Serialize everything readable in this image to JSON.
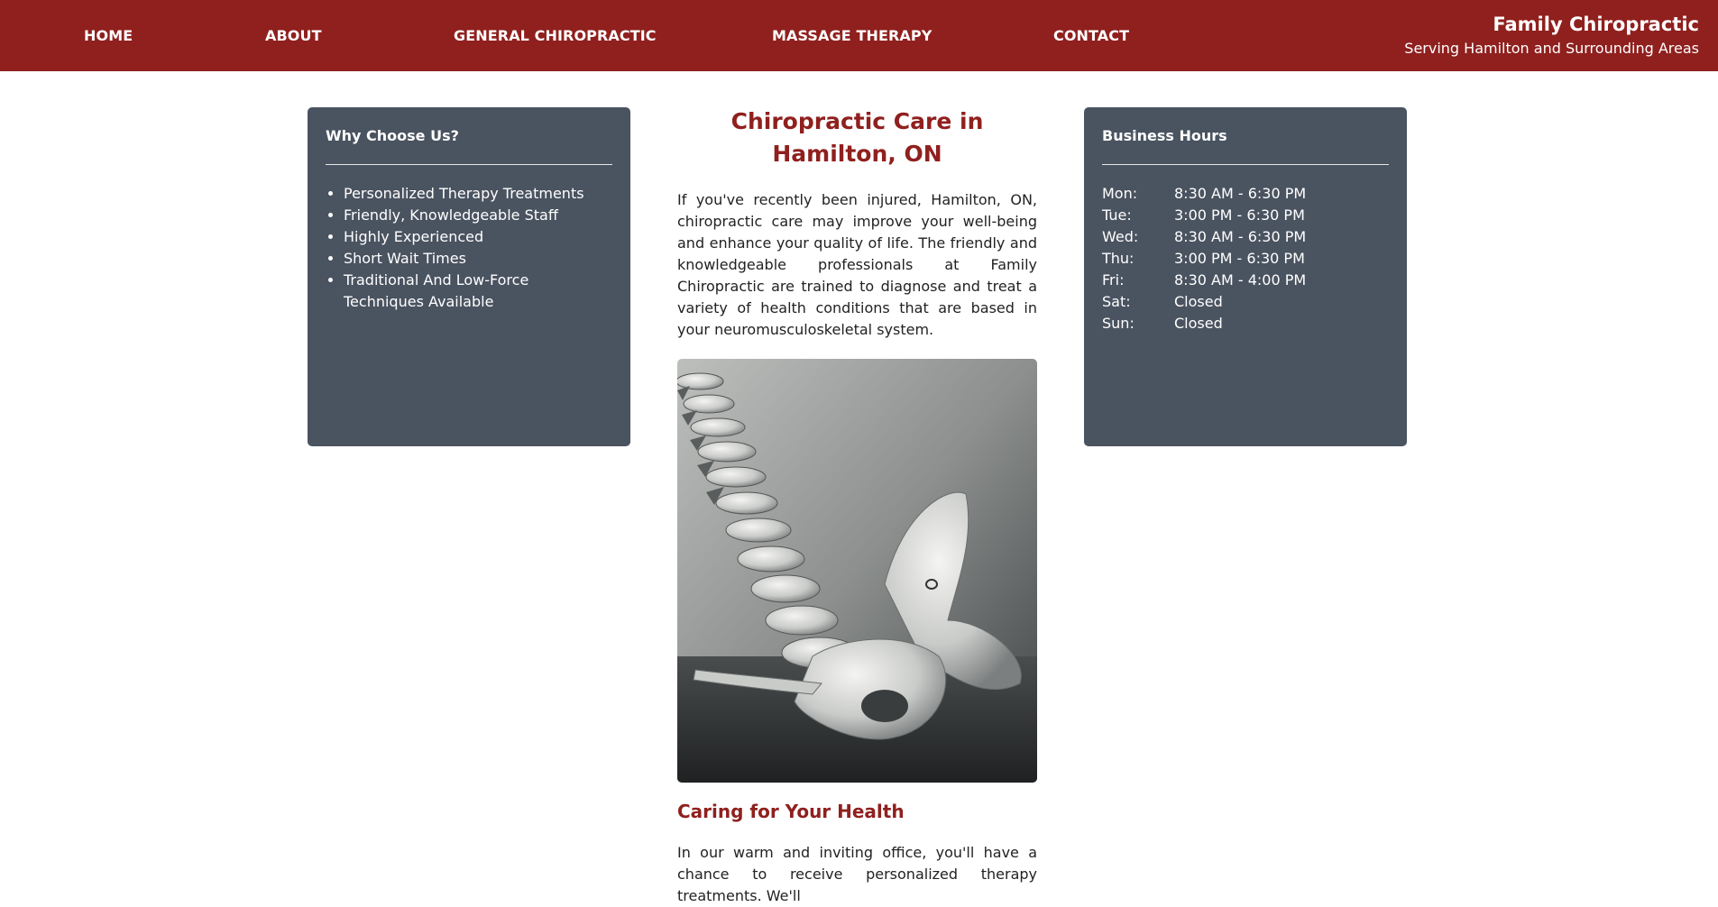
{
  "nav": {
    "items": [
      {
        "label": "HOME"
      },
      {
        "label": "ABOUT"
      },
      {
        "label": "GENERAL CHIROPRACTIC"
      },
      {
        "label": "MASSAGE THERAPY"
      },
      {
        "label": "CONTACT"
      }
    ]
  },
  "brand": {
    "title": "Family Chiropractic",
    "subtitle": "Serving Hamilton and Surrounding Areas"
  },
  "why": {
    "heading": "Why Choose Us?",
    "items": [
      "Personalized Therapy Treatments",
      "Friendly, Knowledgeable Staff",
      "Highly Experienced",
      "Short Wait Times",
      "Traditional And Low-Force Techniques Available"
    ]
  },
  "main": {
    "title": "Chiropractic Care in Hamilton, ON",
    "intro": "If you've recently been injured, Hamilton, ON, chiropractic care may improve your well-being and enhance your quality of life. The friendly and knowledgeable professionals at Family Chiropractic are trained to diagnose and treat a variety of health conditions that are based in your neuromusculoskeletal system.",
    "subheading": "Caring for Your Health",
    "second": "In our warm and inviting office, you'll have a chance to receive personalized therapy treatments. We'll"
  },
  "hours": {
    "heading": "Business Hours",
    "rows": [
      {
        "day": "Mon:",
        "time": "8:30 AM - 6:30 PM"
      },
      {
        "day": "Tue:",
        "time": "3:00 PM - 6:30 PM"
      },
      {
        "day": "Wed:",
        "time": "8:30 AM - 6:30 PM"
      },
      {
        "day": "Thu:",
        "time": "3:00 PM - 6:30 PM"
      },
      {
        "day": "Fri:",
        "time": "8:30 AM - 4:00 PM"
      },
      {
        "day": "Sat:",
        "time": "Closed"
      },
      {
        "day": "Sun:",
        "time": "Closed"
      }
    ]
  },
  "colors": {
    "brand": "#8f201e",
    "panel": "#4a5360"
  }
}
